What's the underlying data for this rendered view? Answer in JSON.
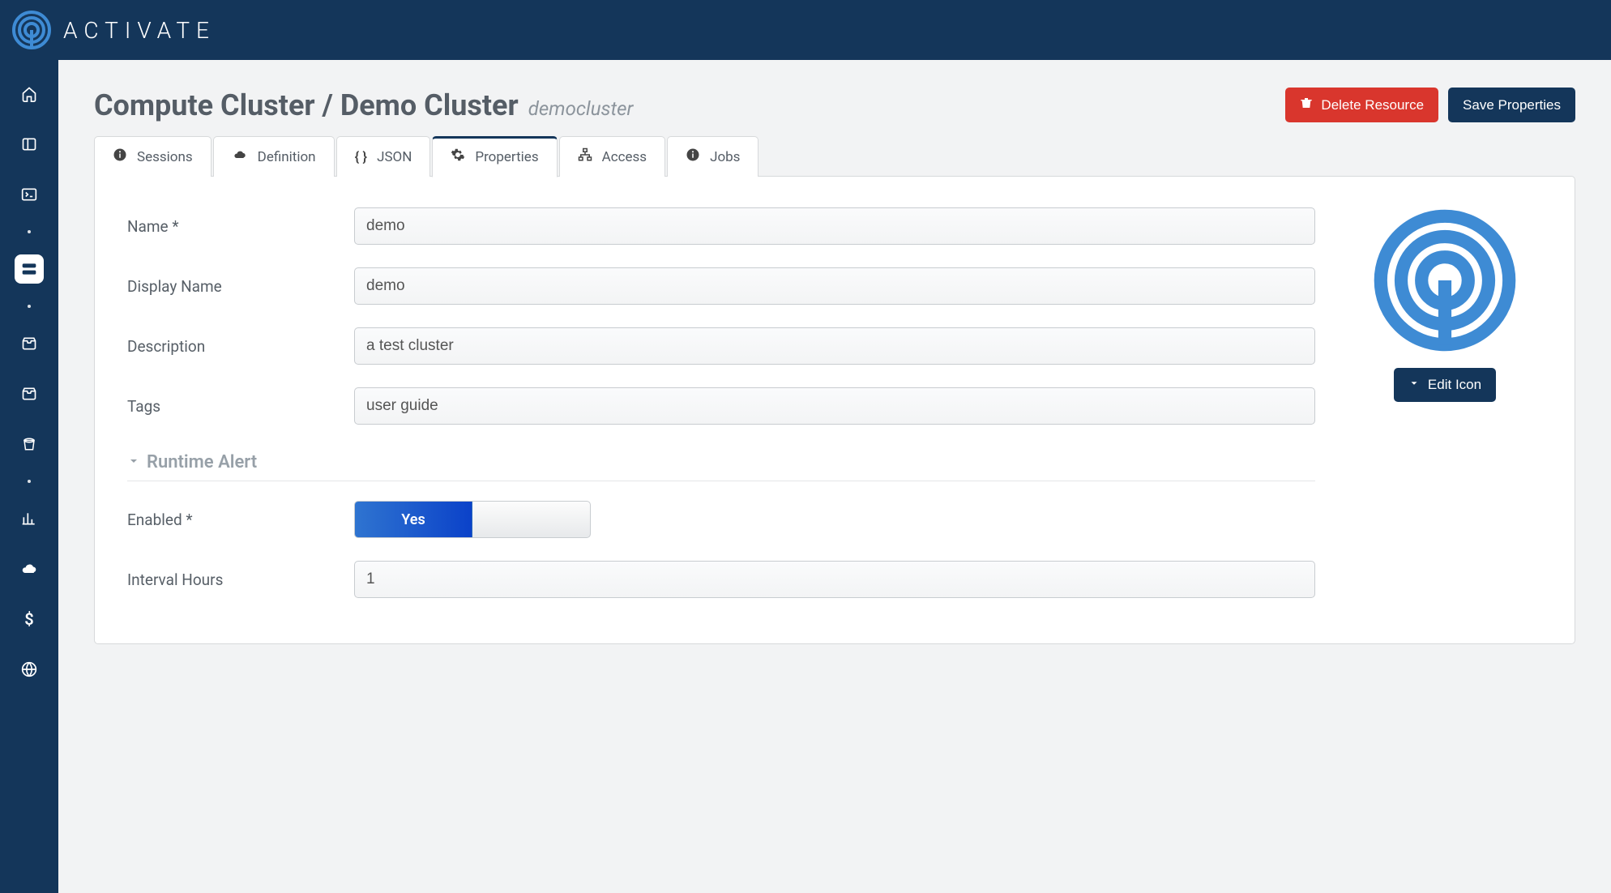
{
  "brand": {
    "name": "ACTIVATE"
  },
  "header": {
    "breadcrumb_prefix": "Compute Cluster / ",
    "title": "Demo Cluster",
    "subtitle": "democluster",
    "delete_label": "Delete Resource",
    "save_label": "Save Properties"
  },
  "tabs": {
    "sessions": "Sessions",
    "definition": "Definition",
    "json": "JSON",
    "properties": "Properties",
    "access": "Access",
    "jobs": "Jobs"
  },
  "form": {
    "name_label": "Name *",
    "name_value": "demo",
    "display_name_label": "Display Name",
    "display_name_value": "demo",
    "description_label": "Description",
    "description_value": "a test cluster",
    "tags_label": "Tags",
    "tags_value": "user guide",
    "runtime_alert_heading": "Runtime Alert",
    "enabled_label": "Enabled *",
    "enabled_value": "Yes",
    "interval_label": "Interval Hours",
    "interval_value": "1"
  },
  "icon_panel": {
    "edit_icon_label": "Edit Icon"
  }
}
